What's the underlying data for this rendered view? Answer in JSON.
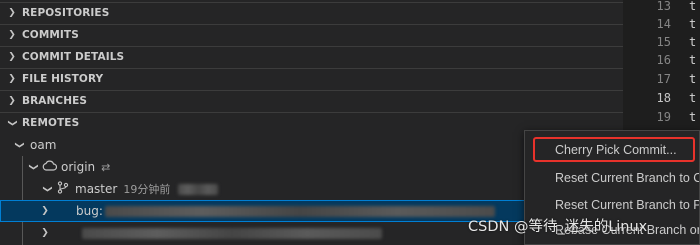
{
  "sections": [
    {
      "label": "REPOSITORIES",
      "expanded": false,
      "icon": "chevron-right-icon"
    },
    {
      "label": "COMMITS",
      "expanded": false,
      "icon": "chevron-right-icon"
    },
    {
      "label": "COMMIT DETAILS",
      "expanded": false,
      "icon": "chevron-right-icon"
    },
    {
      "label": "FILE HISTORY",
      "expanded": false,
      "icon": "chevron-right-icon"
    },
    {
      "label": "BRANCHES",
      "expanded": false,
      "icon": "chevron-right-icon"
    },
    {
      "label": "REMOTES",
      "expanded": true,
      "icon": "chevron-down-icon"
    }
  ],
  "remotes": {
    "repo": {
      "label": "oam"
    },
    "remote": {
      "label": "origin",
      "icon": "cloud-icon",
      "sync_icon": "sync-icon"
    },
    "branch": {
      "label": "master",
      "icon": "git-branch-icon",
      "time": "19分钟前"
    },
    "child_branch": {
      "label": "bug:"
    }
  },
  "editor": {
    "lines": [
      {
        "number": "13",
        "text": "t"
      },
      {
        "number": "14",
        "text": "t"
      },
      {
        "number": "15",
        "text": "t"
      },
      {
        "number": "16",
        "text": "t"
      },
      {
        "number": "17",
        "text": "t"
      },
      {
        "number": "18",
        "text": "t",
        "active": true
      },
      {
        "number": "19",
        "text": "t"
      }
    ]
  },
  "context_menu": {
    "items": [
      {
        "label": "Cherry Pick Commit...",
        "highlighted": true
      },
      {
        "label": "Reset Current Branch to C"
      },
      {
        "label": "Reset Current Branch to P"
      },
      {
        "label": "Rebase Current Branch or"
      }
    ]
  },
  "watermark": "CSDN @等待_迷失的Linux",
  "colors": {
    "sidebar_bg": "#252526",
    "editor_bg": "#1e1e1e",
    "selection_bg": "#04395e",
    "selection_border": "#007fd4",
    "highlight_box": "#e8322b"
  }
}
